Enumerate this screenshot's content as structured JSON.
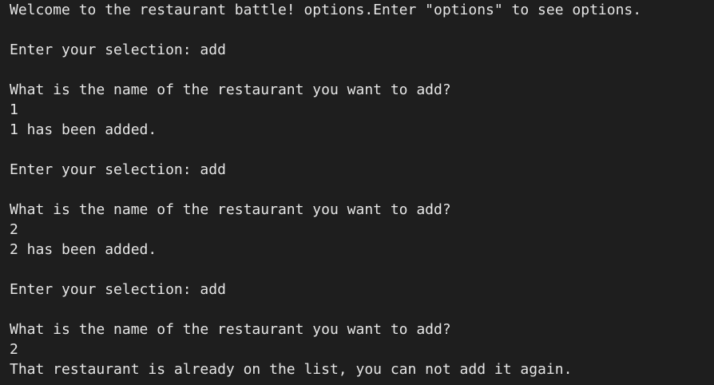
{
  "terminal": {
    "lines": [
      "Welcome to the restaurant battle! options.Enter \"options\" to see options.",
      "",
      "Enter your selection: add",
      "",
      "What is the name of the restaurant you want to add?",
      "1",
      "1 has been added.",
      "",
      "Enter your selection: add",
      "",
      "What is the name of the restaurant you want to add?",
      "2",
      "2 has been added.",
      "",
      "Enter your selection: add",
      "",
      "What is the name of the restaurant you want to add?",
      "2",
      "That restaurant is already on the list, you can not add it again."
    ]
  },
  "colors": {
    "background": "#1e1e1e",
    "text": "#e6e6e6"
  }
}
